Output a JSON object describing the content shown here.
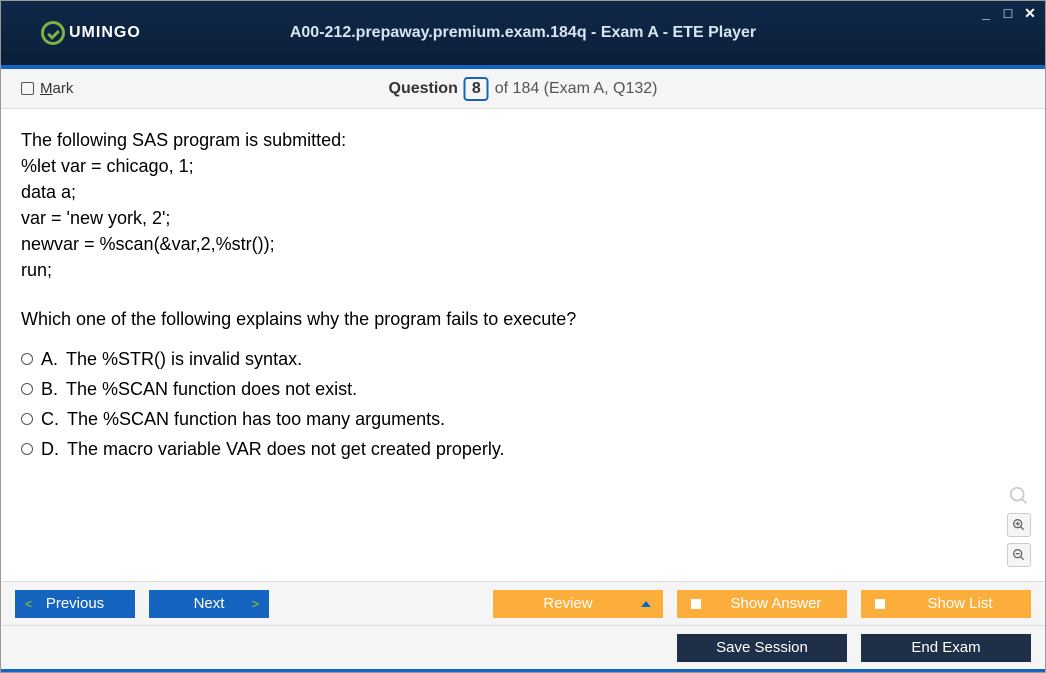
{
  "logo": {
    "text": "UMINGO"
  },
  "title": "A00-212.prepaway.premium.exam.184q - Exam A - ETE Player",
  "header": {
    "mark_label_prefix": "",
    "mark_letter": "M",
    "mark_rest": "ark",
    "question_label": "Question",
    "question_number": "8",
    "of_text": "of 184 (Exam A, Q132)"
  },
  "question": {
    "intro": "The following SAS program is submitted:",
    "code": [
      "%let var = chicago, 1;",
      "data a;",
      "var = 'new york, 2';",
      "newvar = %scan(&var,2,%str());",
      "run;"
    ],
    "prompt": "Which one of the following explains why the program fails to execute?",
    "options": [
      {
        "letter": "A.",
        "text": "The %STR() is invalid syntax."
      },
      {
        "letter": "B.",
        "text": "The %SCAN function does not exist."
      },
      {
        "letter": "C.",
        "text": "The %SCAN function has too many arguments."
      },
      {
        "letter": "D.",
        "text": "The macro variable VAR does not get created properly."
      }
    ]
  },
  "buttons": {
    "previous": "Previous",
    "next": "Next",
    "review": "Review",
    "show_answer": "Show Answer",
    "show_list": "Show List",
    "save_session": "Save Session",
    "end_exam": "End Exam"
  }
}
